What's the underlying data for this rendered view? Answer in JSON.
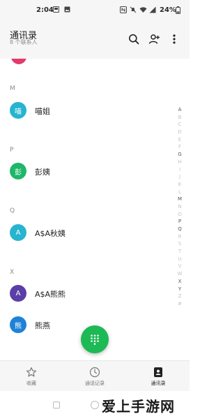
{
  "status_bar": {
    "time": "2:04",
    "battery": "24%"
  },
  "header": {
    "title": "通讯录",
    "subtitle": "8 个联系人"
  },
  "sections": [
    {
      "letter": "M",
      "contacts": [
        {
          "avatar_text": "喵",
          "name": "喵姐",
          "color": "#27b4cf"
        }
      ]
    },
    {
      "letter": "P",
      "contacts": [
        {
          "avatar_text": "彭",
          "name": "彭姨",
          "color": "#1eb76a"
        }
      ]
    },
    {
      "letter": "Q",
      "contacts": [
        {
          "avatar_text": "A",
          "name": "A$A秋姨",
          "color": "#27b4cf"
        }
      ]
    },
    {
      "letter": "X",
      "contacts": [
        {
          "avatar_text": "A",
          "name": "A$A熊熊",
          "color": "#5b3ea8"
        },
        {
          "avatar_text": "熊",
          "name": "熊燕",
          "color": "#1f82d6"
        }
      ]
    }
  ],
  "alpha_index": [
    "A",
    "B",
    "C",
    "D",
    "E",
    "F",
    "G",
    "H",
    "I",
    "J",
    "K",
    "L",
    "M",
    "N",
    "O",
    "P",
    "Q",
    "R",
    "S",
    "T",
    "U",
    "V",
    "W",
    "X",
    "Y",
    "Z",
    "#"
  ],
  "alpha_index_active": [
    "A",
    "G",
    "M",
    "P",
    "Q",
    "X",
    "Y"
  ],
  "bottom_nav": {
    "items": [
      {
        "label": "收藏",
        "icon": "star-icon",
        "active": false
      },
      {
        "label": "通话记录",
        "icon": "clock-icon",
        "active": false
      },
      {
        "label": "通讯录",
        "icon": "contacts-icon",
        "active": true
      }
    ]
  },
  "colors": {
    "fab": "#1db954",
    "accent_contact": "#e33a6b"
  },
  "watermark": "爱上手游网"
}
